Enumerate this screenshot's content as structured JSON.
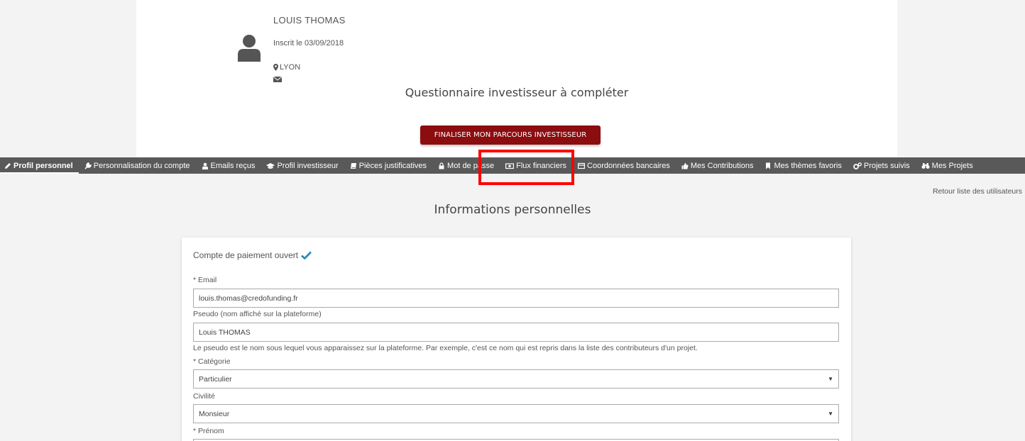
{
  "user": {
    "name": "LOUIS THOMAS",
    "registered": "Inscrit le 03/09/2018",
    "city": "LYON"
  },
  "questionnaire": {
    "title": "Questionnaire investisseur à compléter",
    "button_label": "FINALISER MON PARCOURS INVESTISSEUR"
  },
  "tabs": [
    {
      "label": "Profil personnel",
      "icon": "pencil-icon"
    },
    {
      "label": "Personnalisation du compte",
      "icon": "wrench-icon"
    },
    {
      "label": "Emails reçus",
      "icon": "user-icon"
    },
    {
      "label": "Profil investisseur",
      "icon": "graduation-cap-icon"
    },
    {
      "label": "Pièces justificatives",
      "icon": "book-icon"
    },
    {
      "label": "Mot de passe",
      "icon": "lock-icon"
    },
    {
      "label": "Flux financiers",
      "icon": "money-icon"
    },
    {
      "label": "Coordonnées bancaires",
      "icon": "card-icon"
    },
    {
      "label": "Mes Contributions",
      "icon": "thumbs-up-icon"
    },
    {
      "label": "Mes thèmes favoris",
      "icon": "bookmark-icon"
    },
    {
      "label": "Projets suivis",
      "icon": "cogs-icon"
    },
    {
      "label": "Mes Projets",
      "icon": "binoculars-icon"
    }
  ],
  "back_link": "Retour liste des utilisateurs",
  "section_title": "Informations personnelles",
  "form": {
    "payment_status": "Compte de paiement ouvert",
    "email_label": "* Email",
    "email_value": "louis.thomas@credofunding.fr",
    "pseudo_label": "Pseudo (nom affiché sur la plateforme)",
    "pseudo_value": "Louis THOMAS",
    "pseudo_help": "Le pseudo est le nom sous lequel vous apparaissez sur la plateforme. Par exemple, c'est ce nom qui est repris dans la liste des contributeurs d'un projet.",
    "category_label": "* Catégorie",
    "category_value": "Particulier",
    "civility_label": "Civilité",
    "civility_value": "Monsieur",
    "firstname_label": "* Prénom"
  },
  "colors": {
    "accent_button": "#8b0d10",
    "tabbar": "#595959",
    "highlight": "#ff0000",
    "check": "#2a8bbf"
  }
}
